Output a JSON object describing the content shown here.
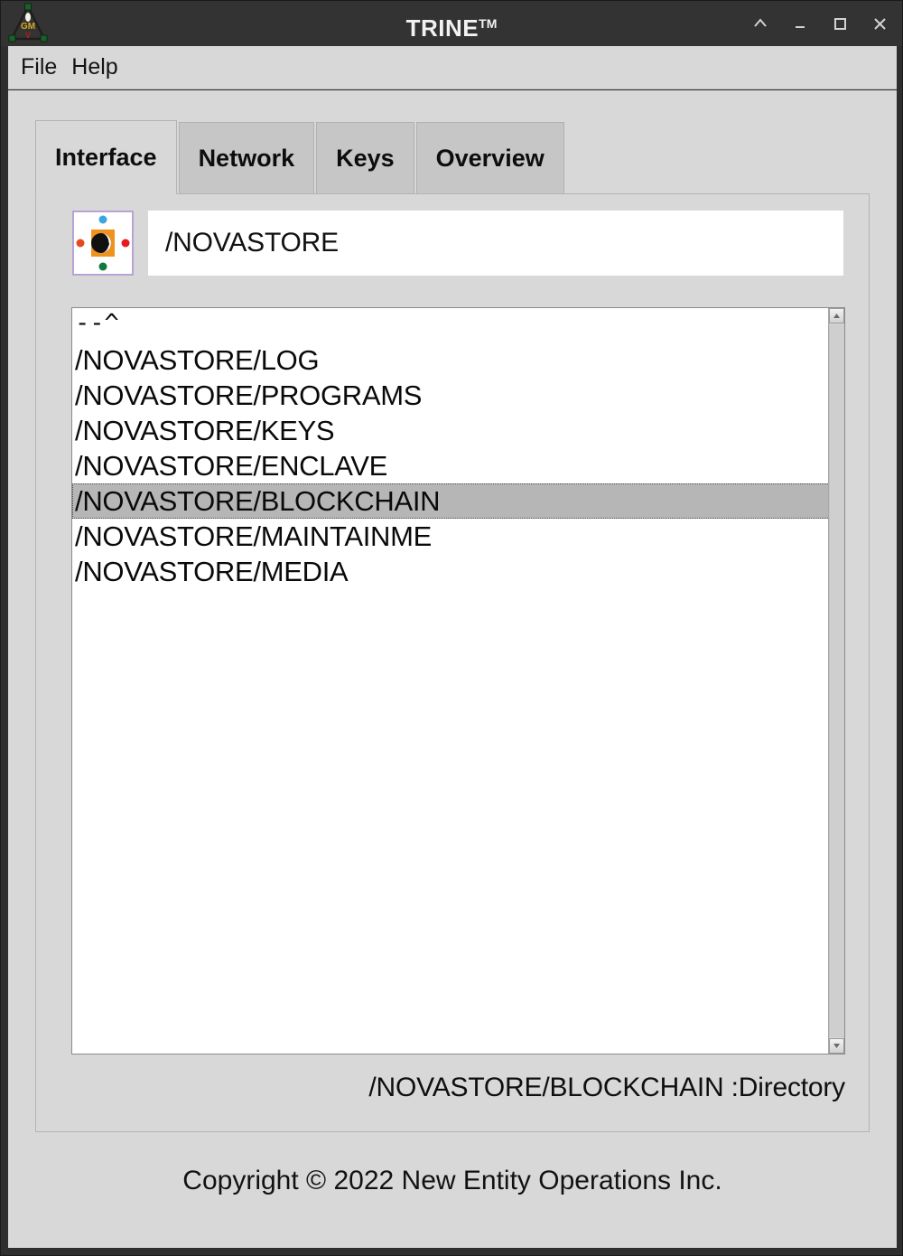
{
  "window": {
    "title": "TRINE",
    "title_suffix": "TM",
    "icon_name": "trine-triangle-logo",
    "controls": [
      {
        "name": "shade-button",
        "glyph": "chevron-up"
      },
      {
        "name": "minimize-button",
        "glyph": "minimize"
      },
      {
        "name": "maximize-button",
        "glyph": "maximize"
      },
      {
        "name": "close-button",
        "glyph": "close"
      }
    ]
  },
  "menubar": {
    "items": [
      {
        "label": "File"
      },
      {
        "label": "Help"
      }
    ]
  },
  "tabs": [
    {
      "label": "Interface",
      "active": true
    },
    {
      "label": "Network",
      "active": false
    },
    {
      "label": "Keys",
      "active": false
    },
    {
      "label": "Overview",
      "active": false
    }
  ],
  "path_row": {
    "icon_name": "eye-directory-icon",
    "value": "/NOVASTORE",
    "placeholder": "/NOVASTORE"
  },
  "file_list": {
    "items": [
      {
        "label": "--^",
        "selected": false,
        "parent": true
      },
      {
        "label": "/NOVASTORE/LOG",
        "selected": false
      },
      {
        "label": "/NOVASTORE/PROGRAMS",
        "selected": false
      },
      {
        "label": "/NOVASTORE/KEYS",
        "selected": false
      },
      {
        "label": "/NOVASTORE/ENCLAVE",
        "selected": false
      },
      {
        "label": "/NOVASTORE/BLOCKCHAIN",
        "selected": true
      },
      {
        "label": "/NOVASTORE/MAINTAINME",
        "selected": false
      },
      {
        "label": "/NOVASTORE/MEDIA",
        "selected": false
      }
    ]
  },
  "status": {
    "text": "/NOVASTORE/BLOCKCHAIN :Directory"
  },
  "footer": {
    "copyright": "Copyright © 2022 New Entity Operations Inc."
  },
  "colors": {
    "titlebar": "#333333",
    "window_bg": "#d8d8d8",
    "tab_inactive": "#c6c6c6",
    "tab_active": "#d8d8d8",
    "selection": "#b6b6b6",
    "field_bg": "#ffffff",
    "icon_border": "#b7a3d4",
    "icon_center": "#f0921e",
    "dot_top": "#3ba7e0",
    "dot_left": "#e8481f",
    "dot_right": "#e8191f",
    "dot_bottom": "#0e7a3c"
  }
}
